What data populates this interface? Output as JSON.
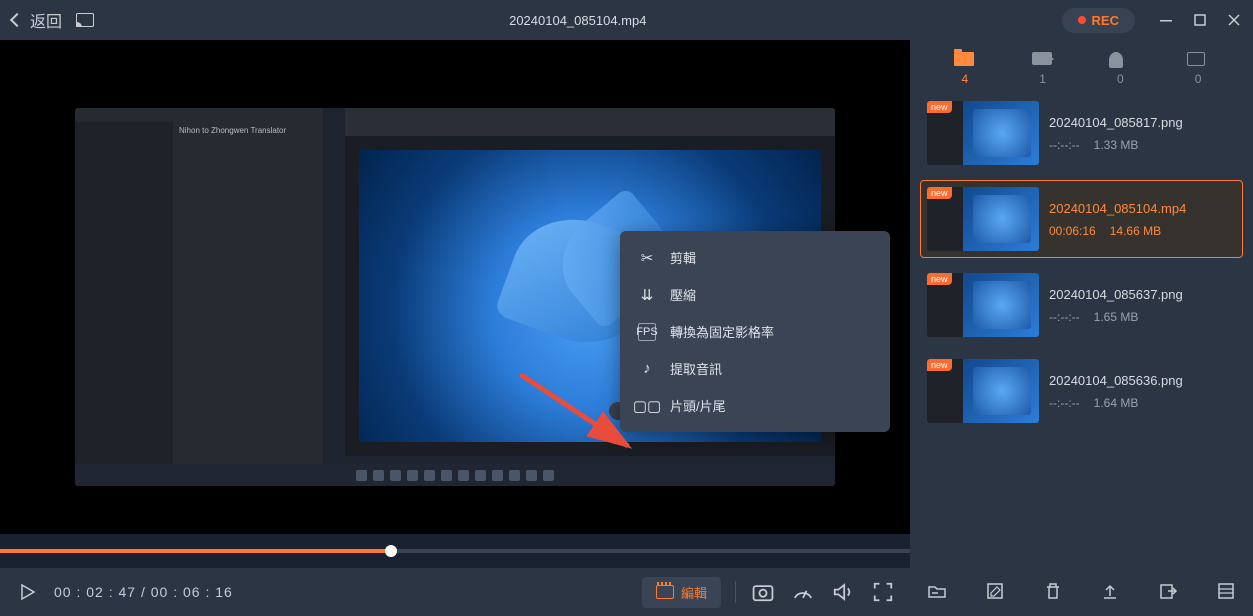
{
  "titlebar": {
    "back": "返回",
    "filename": "20240104_085104.mp4",
    "rec": "REC"
  },
  "ctxmenu": {
    "cut": "剪輯",
    "compress": "壓縮",
    "convert": "轉換為固定影格率",
    "extract": "提取音訊",
    "headtail": "片頭/片尾"
  },
  "player": {
    "currentTime": "00 : 02 : 47",
    "totalTime": "00 : 06 : 16",
    "editLabel": "編輯"
  },
  "tabs": {
    "folder": "4",
    "video": "1",
    "audio": "0",
    "image": "0"
  },
  "files": [
    {
      "name": "20240104_085817.png",
      "duration": "--:--:--",
      "size": "1.33 MB",
      "badge": "new",
      "selected": false
    },
    {
      "name": "20240104_085104.mp4",
      "duration": "00:06:16",
      "size": "14.66 MB",
      "badge": "new",
      "selected": true
    },
    {
      "name": "20240104_085637.png",
      "duration": "--:--:--",
      "size": "1.65 MB",
      "badge": "new",
      "selected": false
    },
    {
      "name": "20240104_085636.png",
      "duration": "--:--:--",
      "size": "1.64 MB",
      "badge": "new",
      "selected": false
    }
  ],
  "shot": {
    "translatorLabel": "Nihon to Zhongwen Translator"
  }
}
